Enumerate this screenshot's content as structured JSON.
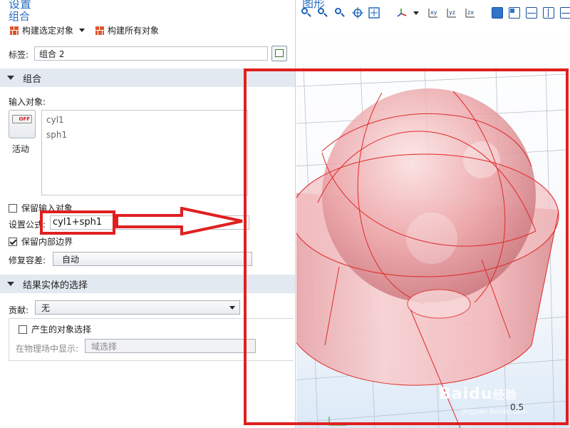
{
  "settings": {
    "title": "设置",
    "subtitle": "组合",
    "build_selected": "构建选定对象",
    "build_all": "构建所有对象",
    "label_caption": "标签:",
    "label_value": "组合 2"
  },
  "combine_section": {
    "header": "组合",
    "input_objects_label": "输入对象:",
    "objects": [
      "cyl1",
      "sph1"
    ],
    "toggle_state": "OFF",
    "active_label": "活动",
    "keep_input_label": "保留输入对象",
    "formula_label": "设置公式:",
    "formula_value": "cyl1+sph1",
    "keep_interior_label": "保留内部边界",
    "repair_label": "修复容差:",
    "repair_value": "自动"
  },
  "selection_section": {
    "header": "结果实体的选择",
    "contribute_label": "贡献:",
    "contribute_value": "无",
    "resulting_selection_label": "产生的对象选择",
    "show_in_physics_label": "在物理场中显示:",
    "show_in_physics_value": "域选择"
  },
  "graphics": {
    "title": "图形",
    "axis_tick": "0.5",
    "toolbar_icons": [
      "zoom-in-icon",
      "zoom-out-icon",
      "zoom-box-icon",
      "zoom-selected-icon",
      "zoom-extents-icon",
      "axis-orientation-icon",
      "view-xy-icon",
      "view-yz-icon",
      "view-zx-icon",
      "view-layout-1-icon",
      "view-layout-2-icon",
      "view-layout-3-icon",
      "view-layout-4-icon",
      "view-layout-5-icon"
    ]
  },
  "watermark": {
    "brand": "Baidu",
    "site": "jingyan.baidu.com",
    "suffix": "经验"
  },
  "colors": {
    "annotation": "#e02020",
    "accent": "#2a6fc0",
    "section_header": "#e3e9f1",
    "solid": "#f0a8ab"
  }
}
